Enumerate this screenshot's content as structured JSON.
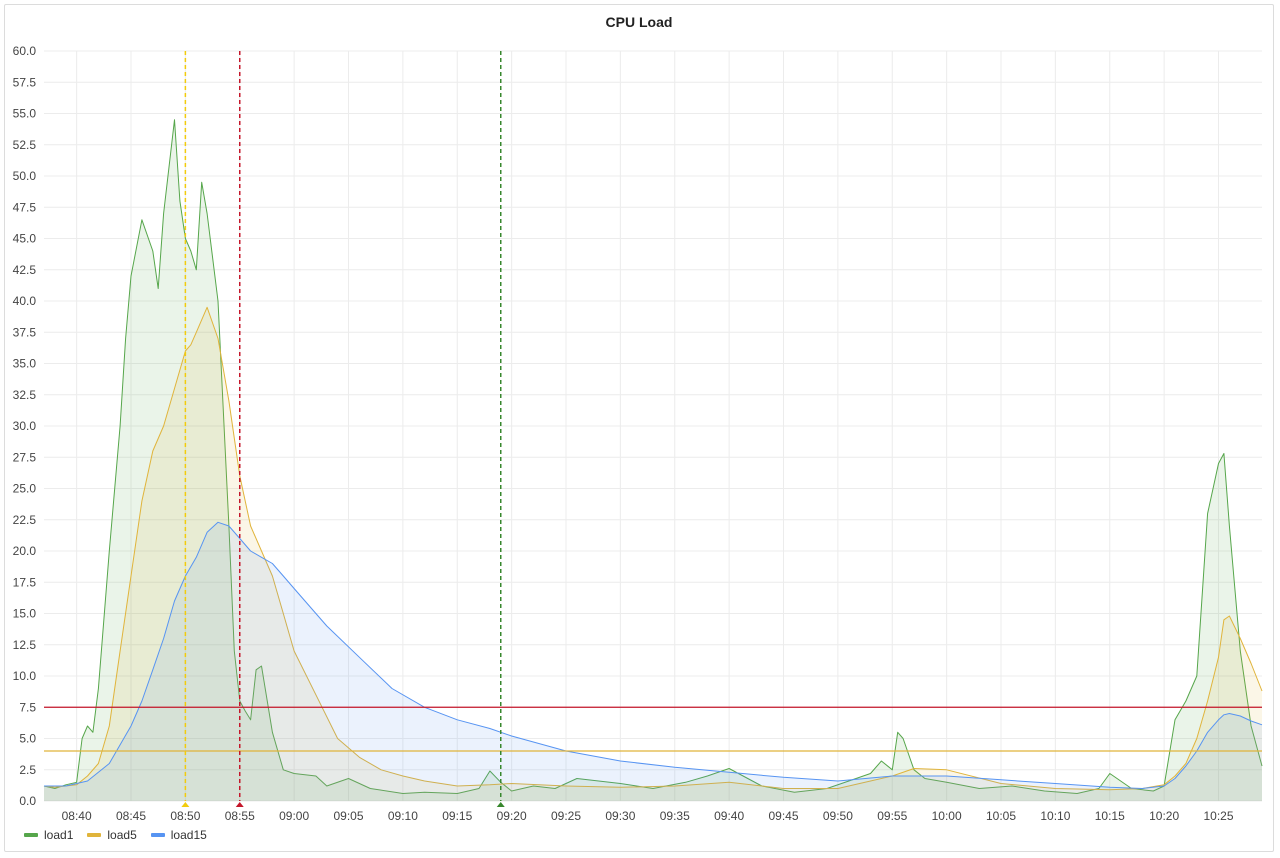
{
  "panel": {
    "title": "CPU Load"
  },
  "chart_data": {
    "type": "area",
    "title": "CPU Load",
    "xlabel": "",
    "ylabel": "",
    "ylim": [
      0,
      60
    ],
    "yticks": [
      "0.0",
      "2.5",
      "5.0",
      "7.5",
      "10.0",
      "12.5",
      "15.0",
      "17.5",
      "20.0",
      "22.5",
      "25.0",
      "27.5",
      "30.0",
      "32.5",
      "35.0",
      "37.5",
      "40.0",
      "42.5",
      "45.0",
      "47.5",
      "50.0",
      "52.5",
      "55.0",
      "57.5",
      "60.0"
    ],
    "xlim": [
      "08:37",
      "10:29"
    ],
    "xticks": [
      "08:40",
      "08:45",
      "08:50",
      "08:55",
      "09:00",
      "09:05",
      "09:10",
      "09:15",
      "09:20",
      "09:25",
      "09:30",
      "09:35",
      "09:40",
      "09:45",
      "09:50",
      "09:55",
      "10:00",
      "10:05",
      "10:10",
      "10:15",
      "10:20",
      "10:25"
    ],
    "grid": true,
    "legend_position": "bottom-left",
    "series": [
      {
        "name": "load1",
        "color": "#56a64b",
        "x": [
          "08:37",
          "08:38",
          "08:39",
          "08:40",
          "08:40:30",
          "08:41",
          "08:41:30",
          "08:42",
          "08:43",
          "08:44",
          "08:44:30",
          "08:45",
          "08:46",
          "08:47",
          "08:47:30",
          "08:48",
          "08:49",
          "08:49:30",
          "08:50",
          "08:50:30",
          "08:51",
          "08:51:30",
          "08:52",
          "08:53",
          "08:54",
          "08:54:30",
          "08:55",
          "08:55:30",
          "08:56",
          "08:56:30",
          "08:57",
          "08:58",
          "08:59",
          "09:00",
          "09:02",
          "09:03",
          "09:05",
          "09:07",
          "09:10",
          "09:12",
          "09:15",
          "09:17",
          "09:18",
          "09:19",
          "09:20",
          "09:22",
          "09:24",
          "09:26",
          "09:30",
          "09:33",
          "09:36",
          "09:38",
          "09:40",
          "09:43",
          "09:46",
          "09:49",
          "09:51",
          "09:53",
          "09:54",
          "09:55",
          "09:55:30",
          "09:56",
          "09:57",
          "09:58",
          "10:00",
          "10:03",
          "10:06",
          "10:09",
          "10:12",
          "10:14",
          "10:15",
          "10:17",
          "10:19",
          "10:20",
          "10:21",
          "10:22",
          "10:23",
          "10:24",
          "10:25",
          "10:25:30",
          "10:26",
          "10:27",
          "10:28",
          "10:29"
        ],
        "values": [
          1.2,
          1.0,
          1.3,
          1.5,
          5.0,
          6.0,
          5.5,
          9.0,
          20.0,
          30.0,
          37.0,
          42.0,
          46.5,
          44.0,
          41.0,
          47.0,
          54.5,
          48.0,
          45.0,
          44.0,
          42.5,
          49.5,
          47.0,
          40.0,
          22.0,
          12.0,
          8.0,
          7.2,
          6.5,
          10.5,
          10.8,
          5.5,
          2.5,
          2.2,
          2.0,
          1.2,
          1.8,
          1.0,
          0.6,
          0.7,
          0.6,
          1.0,
          2.4,
          1.5,
          0.8,
          1.2,
          1.0,
          1.8,
          1.4,
          1.0,
          1.5,
          2.0,
          2.6,
          1.2,
          0.7,
          1.0,
          1.6,
          2.2,
          3.2,
          2.5,
          5.5,
          5.0,
          2.5,
          1.8,
          1.5,
          1.0,
          1.2,
          0.8,
          0.6,
          1.0,
          2.2,
          1.0,
          0.8,
          1.2,
          6.5,
          8.0,
          10.0,
          23.0,
          27.0,
          27.8,
          22.0,
          12.0,
          6.0,
          2.8
        ]
      },
      {
        "name": "load5",
        "color": "#e0b43b",
        "x": [
          "08:37",
          "08:38",
          "08:39",
          "08:40",
          "08:41",
          "08:42",
          "08:43",
          "08:44",
          "08:45",
          "08:46",
          "08:47",
          "08:48",
          "08:49",
          "08:50",
          "08:50:30",
          "08:51",
          "08:52",
          "08:53",
          "08:54",
          "08:55",
          "08:56",
          "08:57",
          "08:58",
          "08:59",
          "09:00",
          "09:02",
          "09:04",
          "09:06",
          "09:08",
          "09:10",
          "09:12",
          "09:15",
          "09:18",
          "09:20",
          "09:25",
          "09:30",
          "09:35",
          "09:40",
          "09:45",
          "09:50",
          "09:53",
          "09:55",
          "09:57",
          "10:00",
          "10:05",
          "10:10",
          "10:15",
          "10:18",
          "10:20",
          "10:21",
          "10:22",
          "10:23",
          "10:24",
          "10:25",
          "10:25:30",
          "10:26",
          "10:27",
          "10:28",
          "10:29"
        ],
        "values": [
          1.2,
          1.1,
          1.2,
          1.3,
          2.0,
          3.0,
          6.0,
          12.0,
          18.0,
          24.0,
          28.0,
          30.0,
          33.0,
          36.0,
          36.5,
          37.5,
          39.5,
          37.0,
          32.0,
          26.0,
          22.0,
          20.0,
          18.0,
          15.0,
          12.0,
          8.5,
          5.0,
          3.5,
          2.5,
          2.0,
          1.6,
          1.2,
          1.3,
          1.4,
          1.2,
          1.1,
          1.2,
          1.5,
          1.0,
          1.0,
          1.6,
          2.0,
          2.6,
          2.5,
          1.4,
          1.0,
          0.9,
          1.0,
          1.3,
          2.0,
          3.0,
          5.0,
          8.0,
          11.5,
          14.5,
          14.8,
          13.0,
          11.0,
          8.8
        ]
      },
      {
        "name": "load15",
        "color": "#5794f2",
        "x": [
          "08:37",
          "08:39",
          "08:41",
          "08:43",
          "08:45",
          "08:46",
          "08:47",
          "08:48",
          "08:49",
          "08:50",
          "08:51",
          "08:52",
          "08:53",
          "08:54",
          "08:55",
          "08:56",
          "08:57",
          "08:58",
          "08:59",
          "09:00",
          "09:03",
          "09:06",
          "09:09",
          "09:12",
          "09:15",
          "09:18",
          "09:20",
          "09:25",
          "09:30",
          "09:35",
          "09:40",
          "09:45",
          "09:50",
          "09:55",
          "10:00",
          "10:05",
          "10:10",
          "10:15",
          "10:18",
          "10:20",
          "10:21",
          "10:22",
          "10:23",
          "10:24",
          "10:25",
          "10:25:30",
          "10:26",
          "10:27",
          "10:28",
          "10:29"
        ],
        "values": [
          1.2,
          1.2,
          1.6,
          3.0,
          6.0,
          8.0,
          10.5,
          13.0,
          16.0,
          18.0,
          19.5,
          21.5,
          22.3,
          22.0,
          21.0,
          20.0,
          19.5,
          19.0,
          18.0,
          17.0,
          14.0,
          11.5,
          9.0,
          7.5,
          6.5,
          5.8,
          5.2,
          4.0,
          3.2,
          2.7,
          2.3,
          1.9,
          1.6,
          2.0,
          2.0,
          1.7,
          1.4,
          1.1,
          1.0,
          1.2,
          1.8,
          2.8,
          4.0,
          5.5,
          6.5,
          6.9,
          7.0,
          6.8,
          6.4,
          6.1
        ]
      }
    ],
    "threshold_lines": [
      {
        "value": 7.5,
        "color": "#c4162a"
      },
      {
        "value": 4.0,
        "color": "#e0b43b"
      }
    ],
    "annotations": [
      {
        "x": "08:50",
        "color": "#f2cc0c"
      },
      {
        "x": "08:55",
        "color": "#c4162a"
      },
      {
        "x": "09:19",
        "color": "#37872d"
      }
    ]
  }
}
